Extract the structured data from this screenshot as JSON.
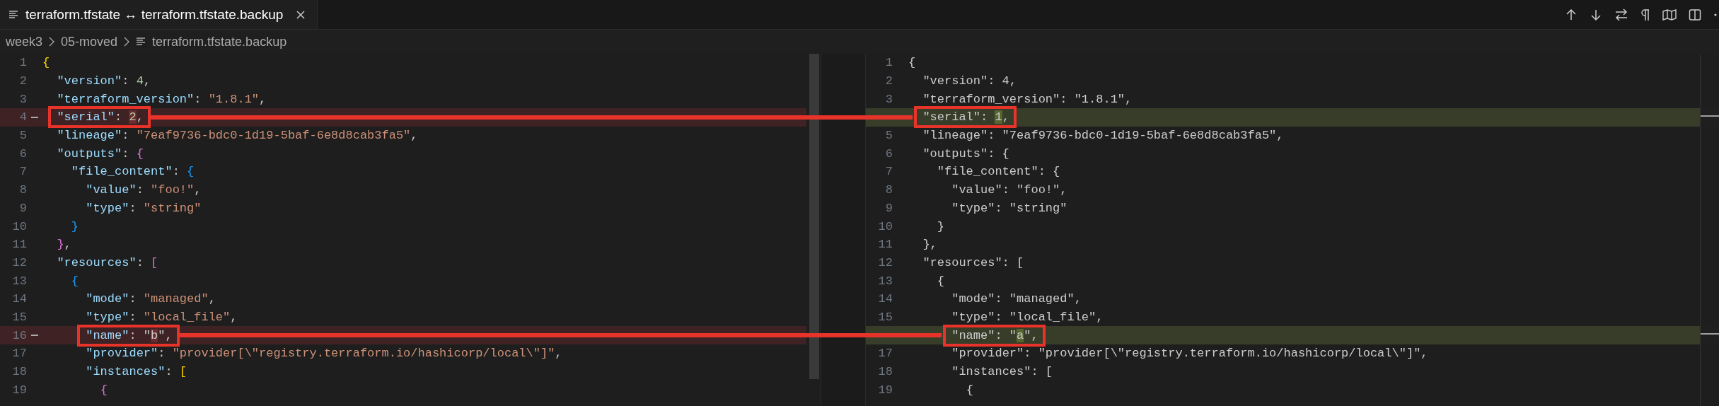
{
  "tab": {
    "label": "terraform.tfstate ↔ terraform.tfstate.backup",
    "selected": true
  },
  "breadcrumb": [
    "week3",
    "05-moved",
    "terraform.tfstate.backup"
  ],
  "panes": [
    {
      "kind": "original",
      "highlighting": true,
      "lines": [
        {
          "num": "1",
          "text": "{",
          "changed": false
        },
        {
          "num": "2",
          "text": "  \"version\": 4,",
          "changed": false
        },
        {
          "num": "3",
          "text": "  \"terraform_version\": \"1.8.1\",",
          "changed": false
        },
        {
          "num": "4",
          "segments": [
            {
              "text": "  \"serial\": ",
              "changed": false
            },
            {
              "text": "2",
              "changed": true
            },
            {
              "text": ",",
              "changed": false
            }
          ],
          "changed": true,
          "annotated": true
        },
        {
          "num": "5",
          "text": "  \"lineage\": \"7eaf9736-bdc0-1d19-5baf-6e8d8cab3fa5\",",
          "changed": false
        },
        {
          "num": "6",
          "text": "  \"outputs\": {",
          "changed": false
        },
        {
          "num": "7",
          "text": "    \"file_content\": {",
          "changed": false
        },
        {
          "num": "8",
          "text": "      \"value\": \"foo!\",",
          "changed": false
        },
        {
          "num": "9",
          "text": "      \"type\": \"string\"",
          "changed": false
        },
        {
          "num": "10",
          "text": "    }",
          "changed": false
        },
        {
          "num": "11",
          "text": "  },",
          "changed": false
        },
        {
          "num": "12",
          "text": "  \"resources\": [",
          "changed": false
        },
        {
          "num": "13",
          "text": "    {",
          "changed": false
        },
        {
          "num": "14",
          "text": "      \"mode\": \"managed\",",
          "changed": false
        },
        {
          "num": "15",
          "text": "      \"type\": \"local_file\",",
          "changed": false
        },
        {
          "num": "16",
          "segments": [
            {
              "text": "      \"name\": \"",
              "changed": false
            },
            {
              "text": "b",
              "changed": true
            },
            {
              "text": "\",",
              "changed": false
            }
          ],
          "changed": true,
          "annotated": true
        },
        {
          "num": "17",
          "text": "      \"provider\": \"provider[\\\"registry.terraform.io/hashicorp/local\\\"]\",",
          "changed": false
        },
        {
          "num": "18",
          "text": "      \"instances\": [",
          "changed": false
        },
        {
          "num": "19",
          "text": "        {",
          "changed": false
        }
      ]
    },
    {
      "kind": "modified",
      "highlighting": false,
      "lines": [
        {
          "num": "1",
          "text": "{",
          "changed": false
        },
        {
          "num": "2",
          "text": "  \"version\": 4,",
          "changed": false
        },
        {
          "num": "3",
          "text": "  \"terraform_version\": \"1.8.1\",",
          "changed": false
        },
        {
          "segments": [
            {
              "text": "  \"serial\": ",
              "changed": false
            },
            {
              "text": "1",
              "changed": true
            },
            {
              "text": ",",
              "changed": false
            }
          ],
          "changed": true,
          "annotated": true
        },
        {
          "num": "5",
          "text": "  \"lineage\": \"7eaf9736-bdc0-1d19-5baf-6e8d8cab3fa5\",",
          "changed": false
        },
        {
          "num": "6",
          "text": "  \"outputs\": {",
          "changed": false
        },
        {
          "num": "7",
          "text": "    \"file_content\": {",
          "changed": false
        },
        {
          "num": "8",
          "text": "      \"value\": \"foo!\",",
          "changed": false
        },
        {
          "num": "9",
          "text": "      \"type\": \"string\"",
          "changed": false
        },
        {
          "num": "10",
          "text": "    }",
          "changed": false
        },
        {
          "num": "11",
          "text": "  },",
          "changed": false
        },
        {
          "num": "12",
          "text": "  \"resources\": [",
          "changed": false
        },
        {
          "num": "13",
          "text": "    {",
          "changed": false
        },
        {
          "num": "14",
          "text": "      \"mode\": \"managed\",",
          "changed": false
        },
        {
          "num": "15",
          "text": "      \"type\": \"local_file\",",
          "changed": false
        },
        {
          "segments": [
            {
              "text": "      \"name\": \"",
              "changed": false
            },
            {
              "text": "a",
              "changed": true
            },
            {
              "text": "\",",
              "changed": false
            }
          ],
          "changed": true,
          "annotated": true
        },
        {
          "num": "17",
          "text": "      \"provider\": \"provider[\\\"registry.terraform.io/hashicorp/local\\\"]\",",
          "changed": false
        },
        {
          "num": "18",
          "text": "      \"instances\": [",
          "changed": false
        },
        {
          "num": "19",
          "text": "        {",
          "changed": false
        }
      ]
    }
  ]
}
